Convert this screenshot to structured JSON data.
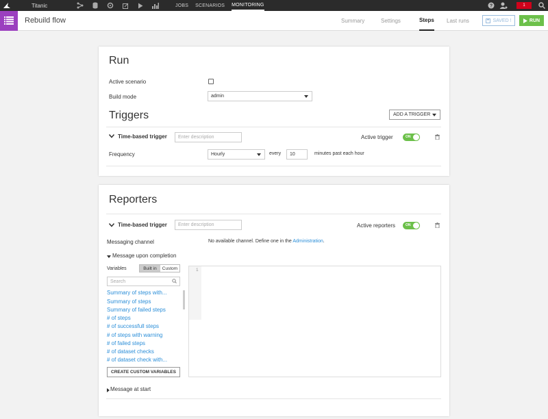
{
  "topnav": {
    "project": "Titanic",
    "menu": [
      "JOBS",
      "SCENARIOS",
      "MONITORING"
    ],
    "notifications": "1",
    "colors": {
      "bar": "#2b2b2b",
      "notification": "#d0021b"
    }
  },
  "header": {
    "title": "Rebuild flow",
    "tabs": [
      "Summary",
      "Settings",
      "Steps",
      "Last runs"
    ],
    "active_tab": "Steps",
    "saved_label": "SAVED !",
    "run_label": "RUN",
    "colors": {
      "flow_icon": "#9b3fbf",
      "run": "#6cc04a"
    }
  },
  "run": {
    "title": "Run",
    "active_scenario_label": "Active scenario",
    "build_mode_label": "Build mode",
    "build_mode_value": "admin"
  },
  "triggers": {
    "title": "Triggers",
    "add_trigger_label": "ADD A TRIGGER",
    "trigger_name": "Time-based trigger",
    "description_placeholder": "Enter description",
    "active_label": "Active trigger",
    "toggle_on": "ON",
    "frequency_label": "Frequency",
    "frequency_value": "Hourly",
    "every_label": "every",
    "minutes_value": "10",
    "minutes_suffix": "minutes past each hour"
  },
  "reporters": {
    "title": "Reporters",
    "reporter_name": "Time-based trigger",
    "description_placeholder": "Enter description",
    "active_label": "Active reporters",
    "toggle_on": "ON",
    "messaging_channel_label": "Messaging channel",
    "channel_message": "No available channel. Define one in the",
    "channel_link": "Administration",
    "channel_period": ".",
    "message_completion_label": "Message upon completion",
    "variables_label": "Variables",
    "builtin_label": "Built in",
    "custom_label": "Custom",
    "search_placeholder": "Search",
    "variables": [
      "Summary of steps with...",
      "Summary of steps",
      "Summary of failed steps",
      "# of steps",
      "# of successfull steps",
      "# of steps with warning",
      "# of failed steps",
      "# of dataset checks",
      "# of dataset check with..."
    ],
    "create_custom_label": "CREATE CUSTOM VARIABLES",
    "editor_line": "1",
    "message_start_label": "Message at start"
  }
}
